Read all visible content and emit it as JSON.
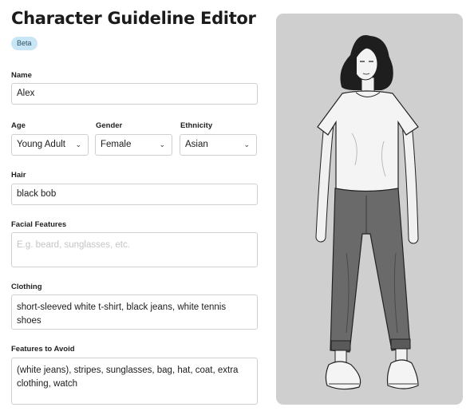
{
  "header": {
    "title": "Character Guideline Editor",
    "badge": "Beta"
  },
  "form": {
    "name": {
      "label": "Name",
      "value": "Alex"
    },
    "age": {
      "label": "Age",
      "value": "Young Adult"
    },
    "gender": {
      "label": "Gender",
      "value": "Female"
    },
    "ethnicity": {
      "label": "Ethnicity",
      "value": "Asian"
    },
    "hair": {
      "label": "Hair",
      "value": "black bob"
    },
    "facial_features": {
      "label": "Facial Features",
      "value": "",
      "placeholder": "E.g. beard, sunglasses, etc."
    },
    "clothing": {
      "label": "Clothing",
      "value": "short-sleeved white t-shirt, black jeans, white tennis shoes"
    },
    "features_to_avoid": {
      "label": "Features to Avoid",
      "value": "(white jeans), stripes, sunglasses, bag, hat, coat, extra clothing, watch"
    }
  },
  "preview": {
    "icon": "character-illustration",
    "colors": {
      "background": "#cfcfcf",
      "shirt": "#f2f2f2",
      "jeans": "#6a6a6a",
      "hair": "#1c1c1c"
    }
  }
}
